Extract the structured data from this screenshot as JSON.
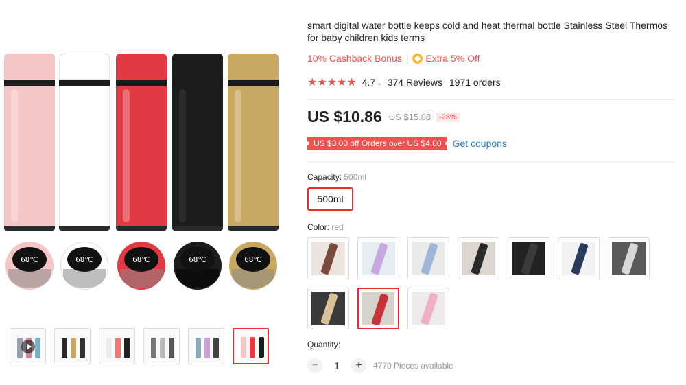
{
  "gallery": {
    "bottle_colors": [
      "#f4c6c6",
      "#ffffff",
      "#e23a43",
      "#1c1c1c",
      "#c9a863"
    ],
    "lid_reading": "68℃",
    "thumbnails": [
      {
        "name": "video-thumbnail",
        "has_play": true,
        "colors": [
          "#9aa0b8",
          "#cc8899",
          "#7ab0c0"
        ]
      },
      {
        "name": "thumbnail-2",
        "colors": [
          "#2b2b2b",
          "#c9a863",
          "#333"
        ]
      },
      {
        "name": "thumbnail-3",
        "colors": [
          "#eee",
          "#e77",
          "#222"
        ]
      },
      {
        "name": "thumbnail-4",
        "colors": [
          "#777",
          "#bbb",
          "#555"
        ]
      },
      {
        "name": "thumbnail-5",
        "colors": [
          "#8ab",
          "#c9a0d8",
          "#444"
        ]
      },
      {
        "name": "thumbnail-6",
        "active": true,
        "colors": [
          "#f4c6c6",
          "#e23a43",
          "#1c1c1c"
        ]
      }
    ]
  },
  "product": {
    "title": "smart digital water bottle keeps cold and heat thermal bottle Stainless Steel Thermos for baby children kids terms",
    "cashback": "10% Cashback Bonus",
    "separator": "|",
    "extra_off": "Extra 5% Off",
    "stars": "★★★★★",
    "rating": "4.7",
    "rating_chevron": "⌄",
    "reviews": "374 Reviews",
    "orders": "1971 orders",
    "price": "US $10.86",
    "old_price": "US $15.08",
    "discount": "-28%",
    "coupon": "US $3.00 off Orders over US $4.00",
    "get_coupons": "Get coupons"
  },
  "capacity": {
    "label": "Capacity:",
    "value": "500ml",
    "option": "500ml"
  },
  "color": {
    "label": "Color:",
    "value": "red",
    "swatches": [
      {
        "bg": "#ece4de",
        "stick": "#7a4a3a"
      },
      {
        "bg": "#e4eef2",
        "stick": "#c8a8e0"
      },
      {
        "bg": "#eaeaea",
        "stick": "#9fb6d8"
      },
      {
        "bg": "#dcd6cf",
        "stick": "#2a2a2a"
      },
      {
        "bg": "#222222",
        "stick": "#3a3a3a"
      },
      {
        "bg": "#f2f2f2",
        "stick": "#2a3a5a"
      },
      {
        "bg": "#5a5a5a",
        "stick": "#d8d8d8"
      },
      {
        "bg": "#3a3a3a",
        "stick": "#d7c29a"
      },
      {
        "bg": "#d8d2cc",
        "stick": "#c8323a",
        "selected": true
      },
      {
        "bg": "#eeeaea",
        "stick": "#f0b0c4"
      }
    ]
  },
  "quantity": {
    "label": "Quantity:",
    "minus": "−",
    "plus": "+",
    "value": "1",
    "available": "4770 Pieces available"
  },
  "colors": {
    "accent_red": "#f0504f",
    "selection_red": "#e52f2f",
    "link_blue": "#2e7fc9",
    "coin_yellow": "#f7b733"
  }
}
